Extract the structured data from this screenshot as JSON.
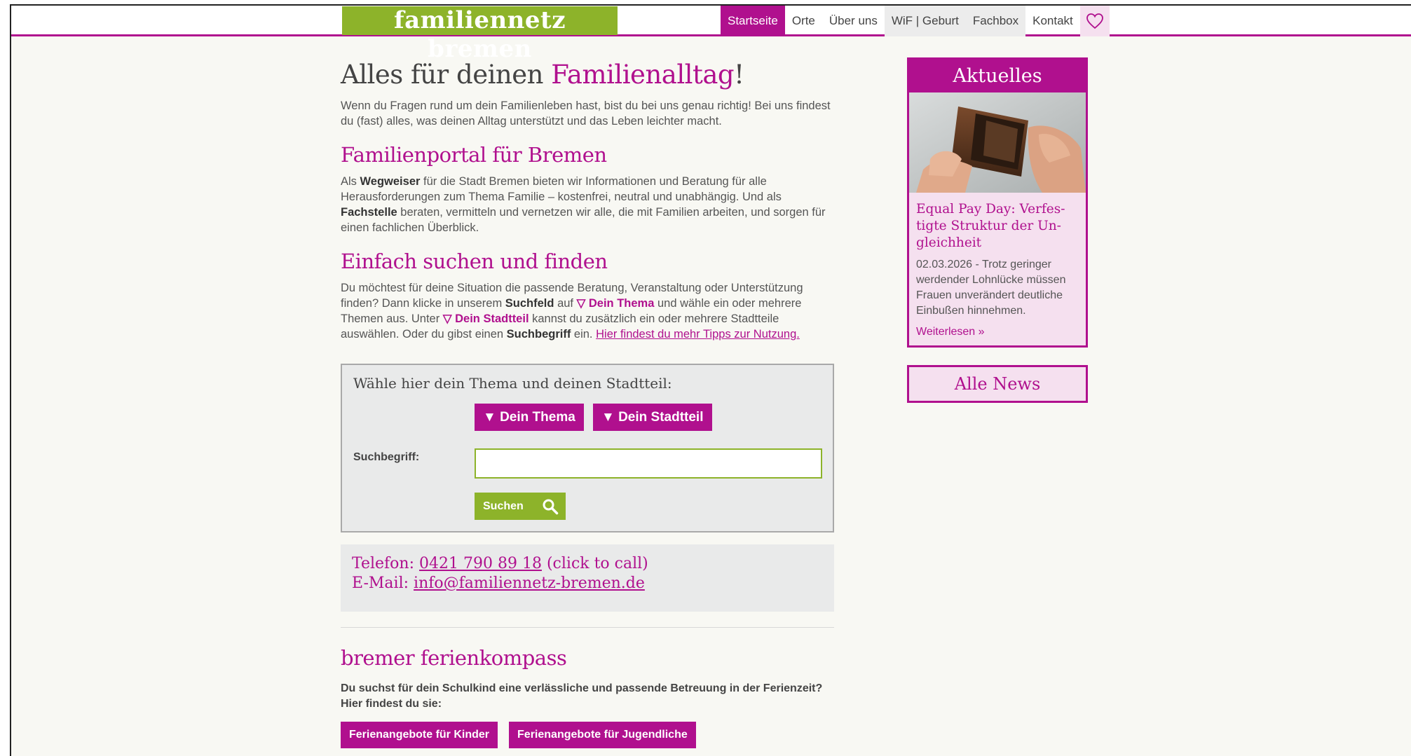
{
  "header": {
    "logo": "familiennetz bremen",
    "nav": [
      {
        "label": "Startseite",
        "state": "active"
      },
      {
        "label": "Orte",
        "state": "normal"
      },
      {
        "label": "Über uns",
        "state": "normal"
      },
      {
        "label": "WiF | Geburt",
        "state": "grey"
      },
      {
        "label": "Fachbox",
        "state": "grey"
      },
      {
        "label": "Kontakt",
        "state": "normal"
      }
    ],
    "heart_icon": "heart-icon"
  },
  "main": {
    "title_plain": "Alles für deinen ",
    "title_accent": "Familienalltag",
    "title_end": "!",
    "intro": "Wenn du Fragen rund um dein Familienleben hast, bist du bei uns genau richtig! Bei uns findest du (fast) alles, was deinen Alltag unterstützt und das Leben leichter macht.",
    "section1": {
      "heading": "Familienportal für Bremen",
      "t1": "Als ",
      "b1": "Wegweiser",
      "t2": " für die Stadt Bremen bieten wir Informationen und Beratung für alle Herausforderungen zum Thema Familie – kostenfrei, neutral und unabhängig. Und als ",
      "b2": "Fachstelle",
      "t3": " beraten, vermitteln und vernetzen wir alle, die mit Familien arbeiten, und sorgen für einen fachlichen Überblick."
    },
    "section2": {
      "heading": "Einfach suchen und finden",
      "t1": "Du möchtest für deine Situation die passende Beratung, Veranstaltung oder Unterstützung finden? Dann klicke in unserem ",
      "b1": "Suchfeld",
      "t2": " auf ",
      "p1": "▽ Dein Thema",
      "t3": " und wähle ein oder mehrere Themen aus. Unter ",
      "p2": "▽ Dein Stadtteil",
      "t4": " kannst du zusätzlich ein oder mehrere Stadtteile auswählen. Oder du gibst einen ",
      "b2": "Suchbegriff",
      "t5": " ein. ",
      "link": "Hier findest du mehr Tipps zur Nutzung."
    }
  },
  "search": {
    "title": "Wähle hier dein Thema und deinen Stadtteil:",
    "topic_button": "▼ Dein Thema",
    "district_button": "▼ Dein Stadtteil",
    "term_label": "Suchbegriff:",
    "term_value": "",
    "submit_label": "Suchen"
  },
  "contact": {
    "phone_prefix": "Telefon: ",
    "phone": "0421 790 89 18",
    "phone_suffix": " (click to call)",
    "email_prefix": "E-Mail: ",
    "email": "info@familiennetz-bremen.de"
  },
  "ferien": {
    "heading": "bremer ferienkompass",
    "text": "Du suchst für dein Schulkind eine verlässliche und passende Betreuung in der Ferienzeit? Hier findest du sie:",
    "btn_kids": "Ferienangebote für Kinder",
    "btn_youth": "Ferienangebote für Jugendliche"
  },
  "news": {
    "heading": "Aktuelles",
    "article_title": "Equal Pay Day: Verfes­tigte Struktur der Un­gleichheit",
    "article_text": "02.03.2026 - Trotz geringer werdender Lohnlücke müssen Frauen unverändert deutliche Einbußen hinnehmen.",
    "more": "Weiterlesen »",
    "all_news": "Alle News"
  },
  "colors": {
    "brand_pink": "#b0108e",
    "brand_green": "#8db32a",
    "background": "#f8f8f3"
  }
}
